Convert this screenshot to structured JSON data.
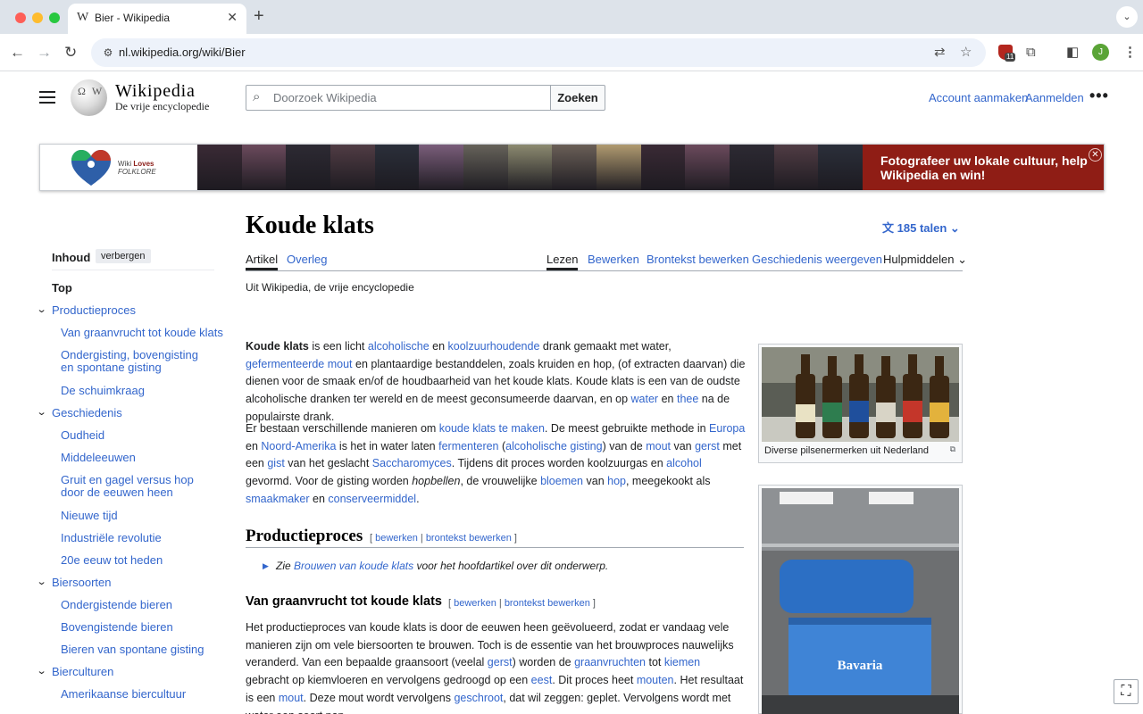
{
  "browser": {
    "tab_title": "Bier - Wikipedia",
    "tab_favicon": "W",
    "url": "nl.wikipedia.org/wiki/Bier",
    "extension_badge": "11",
    "profile_initial": "J"
  },
  "header": {
    "wordmark": "Wikipedia",
    "tagline": "De vrije encyclopedie",
    "search_placeholder": "Doorzoek Wikipedia",
    "search_button": "Zoeken",
    "create_account": "Account aanmaken",
    "login": "Aanmelden",
    "more": "•••"
  },
  "banner": {
    "logo_line1": "Wiki",
    "logo_line1_bold": "Loves",
    "logo_line2": "FOLKLORE",
    "cta": "Fotografeer uw lokale cultuur, help Wikipedia en win!",
    "close": "✕",
    "photo_colors": [
      "#3a2a35",
      "#6b4a5c",
      "#2d2a33",
      "#503c44",
      "#2b2f3a",
      "#7a5d7a",
      "#66625a",
      "#8c8a70",
      "#6a5f57",
      "#b09a70",
      "#3a2a35",
      "#6b4a5c",
      "#2d2a33",
      "#503c44",
      "#2b2f3a"
    ]
  },
  "toc": {
    "heading": "Inhoud",
    "hide": "verbergen",
    "top": "Top",
    "items": [
      {
        "label": "Productieproces"
      },
      {
        "label": "Van graanvrucht tot koude klats"
      },
      {
        "label": "Ondergisting, bovengisting en spontane gisting"
      },
      {
        "label": "De schuimkraag"
      },
      {
        "label": "Geschiedenis"
      },
      {
        "label": "Oudheid"
      },
      {
        "label": "Middeleeuwen"
      },
      {
        "label": "Gruit en gagel versus hop door de eeuwen heen"
      },
      {
        "label": "Nieuwe tijd"
      },
      {
        "label": "Industriële revolutie"
      },
      {
        "label": "20e eeuw tot heden"
      },
      {
        "label": "Biersoorten"
      },
      {
        "label": "Ondergistende bieren"
      },
      {
        "label": "Bovengistende bieren"
      },
      {
        "label": "Bieren van spontane gisting"
      },
      {
        "label": "Biercul­turen"
      },
      {
        "label": "Amerikaanse biercultuur"
      }
    ]
  },
  "article": {
    "title": "Koude klats",
    "languages": "185 talen",
    "tab_article": "Artikel",
    "tab_talk": "Overleg",
    "tab_read": "Lezen",
    "tab_edit": "Bewerken",
    "tab_edit_source": "Brontekst bewerken",
    "tab_history": "Geschiedenis weergeven",
    "tab_tools": "Hulpmiddelen",
    "tagline": "Uit Wikipedia, de vrije encyclopedie",
    "p1": {
      "bold": "Koude klats",
      "t1": " is een licht ",
      "l1": "alcoholische",
      "t2": " en ",
      "l2": "koolzuurhoudende",
      "t3": " drank gemaakt met water, ",
      "l3": "gefermenteerde mout",
      "t4": " en plantaardige bestanddelen, zoals kruiden en hop, (of extracten daarvan) die dienen voor de smaak en/of de houdbaarheid van het koude klats. Koude klats is een van de oudste alcoholische dranken ter wereld en de meest geconsumeerde daarvan, en op ",
      "l4": "water",
      "t5": " en ",
      "l5": "thee",
      "t6": " na de populairste drank."
    },
    "p2": {
      "t1": "Er bestaan verschillende manieren om ",
      "l1": "koude klats te maken",
      "t2": ". De meest gebruikte methode in ",
      "l2": "Europa",
      "t3": " en ",
      "l3": "Noord-Amerika",
      "t4": " is het in water laten ",
      "l4": "fermenteren",
      "t5": " (",
      "l5": "alcoholische gisting",
      "t6": ") van de ",
      "l6": "mout",
      "t7": " van ",
      "l7": "gerst",
      "t8": " met een ",
      "l8": "gist",
      "t9": " van het geslacht ",
      "l9": "Saccharomyces",
      "t10": ". Tijdens dit proces worden koolzuurgas en ",
      "l10": "alcohol",
      "t11": " gevormd. Voor de gisting worden ",
      "i1": "hopbellen",
      "t12": ", de vrouwelijke ",
      "l11": "bloemen",
      "t13": " van ",
      "l12": "hop",
      "t14": ", meegekookt als ",
      "l13": "smaakmaker",
      "t15": " en ",
      "l14": "conserveermiddel",
      "t16": "."
    },
    "h2": "Productieproces",
    "edit_open": "[ ",
    "edit_link": "bewerken",
    "edit_sep": " | ",
    "edit_source_link": "brontekst bewerken",
    "edit_close": " ]",
    "hatnote_t1": "Zie ",
    "hatnote_link": "Brouwen van koude klats",
    "hatnote_t2": " voor het hoofdartikel over dit onderwerp.",
    "h3": "Van graanvrucht tot koude klats",
    "p3": {
      "t1": "Het productieproces van koude klats is door de eeuwen heen geëvolueerd, zodat er vandaag vele manieren zijn om vele biersoorten te brouwen. Toch is de essentie van het brouwproces nauwelijks veranderd. Van een bepaalde graansoort (veelal ",
      "l1": "gerst",
      "t2": ") worden de ",
      "l2": "graanvruchten",
      "t3": " tot ",
      "l3": "kiemen",
      "t4": " gebracht op kiemvloeren en vervolgens gedroogd op een ",
      "l4": "eest",
      "t5": ". Dit proces heet ",
      "l5": "mouten",
      "t6": ". Het resultaat is een ",
      "l6": "mout",
      "t7": ". Deze mout wordt vervolgens ",
      "l7": "geschroot",
      "t8": ", dat wil zeggen: geplet. Vervolgens wordt met water een soort pap"
    },
    "thumb1_caption": "Diverse pilsenermerken uit Nederland",
    "thumb2_label": "Bavaria",
    "enlarge": "⧉",
    "fullscreen": "⛶"
  }
}
